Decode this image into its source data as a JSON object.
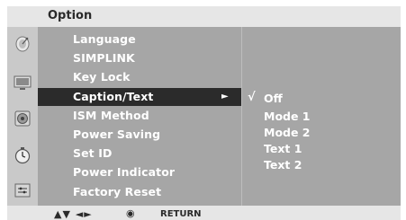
{
  "header": {
    "title": "Option"
  },
  "menu": {
    "items": [
      {
        "label": "Language"
      },
      {
        "label": "SIMPLINK"
      },
      {
        "label": "Key Lock"
      },
      {
        "label": "Caption/Text",
        "arrow": "►"
      },
      {
        "label": "ISM Method"
      },
      {
        "label": "Power Saving"
      },
      {
        "label": "Set ID"
      },
      {
        "label": "Power Indicator"
      },
      {
        "label": "Factory Reset"
      }
    ],
    "selected_index": 3
  },
  "submenu": {
    "check_mark": "√",
    "options": [
      {
        "label": "Off"
      },
      {
        "label": "Mode 1"
      },
      {
        "label": "Mode 2"
      },
      {
        "label": "Text 1"
      },
      {
        "label": "Text 2"
      }
    ],
    "selected_index": 0
  },
  "side_icons": [
    "satellite-dish-icon",
    "monitor-icon",
    "speaker-icon",
    "clock-icon",
    "options-box-icon"
  ],
  "footer": {
    "nav_arrows": "▲▼ ◄►",
    "ok_symbol": "◉",
    "return_label": "RETURN"
  },
  "colors": {
    "header_bg": "#e6e6e6",
    "pane_bg": "#a6a6a6",
    "icon_col_bg": "#c9c9c9",
    "selected_bg": "#2b2b2b",
    "text": "#ffffff"
  }
}
